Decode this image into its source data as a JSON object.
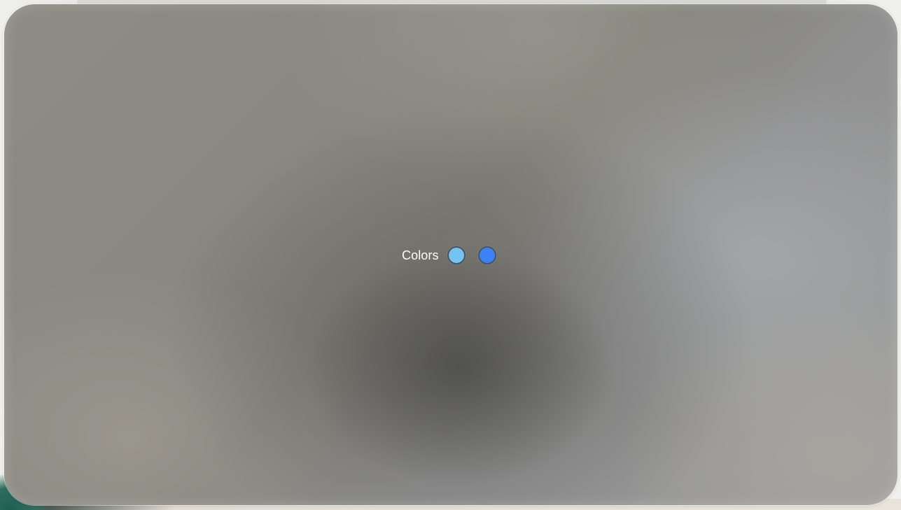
{
  "color_picker": {
    "label": "Colors",
    "swatches": [
      {
        "name": "light-blue",
        "color": "#74c3f0"
      },
      {
        "name": "blue",
        "color": "#3b82f6"
      }
    ]
  }
}
